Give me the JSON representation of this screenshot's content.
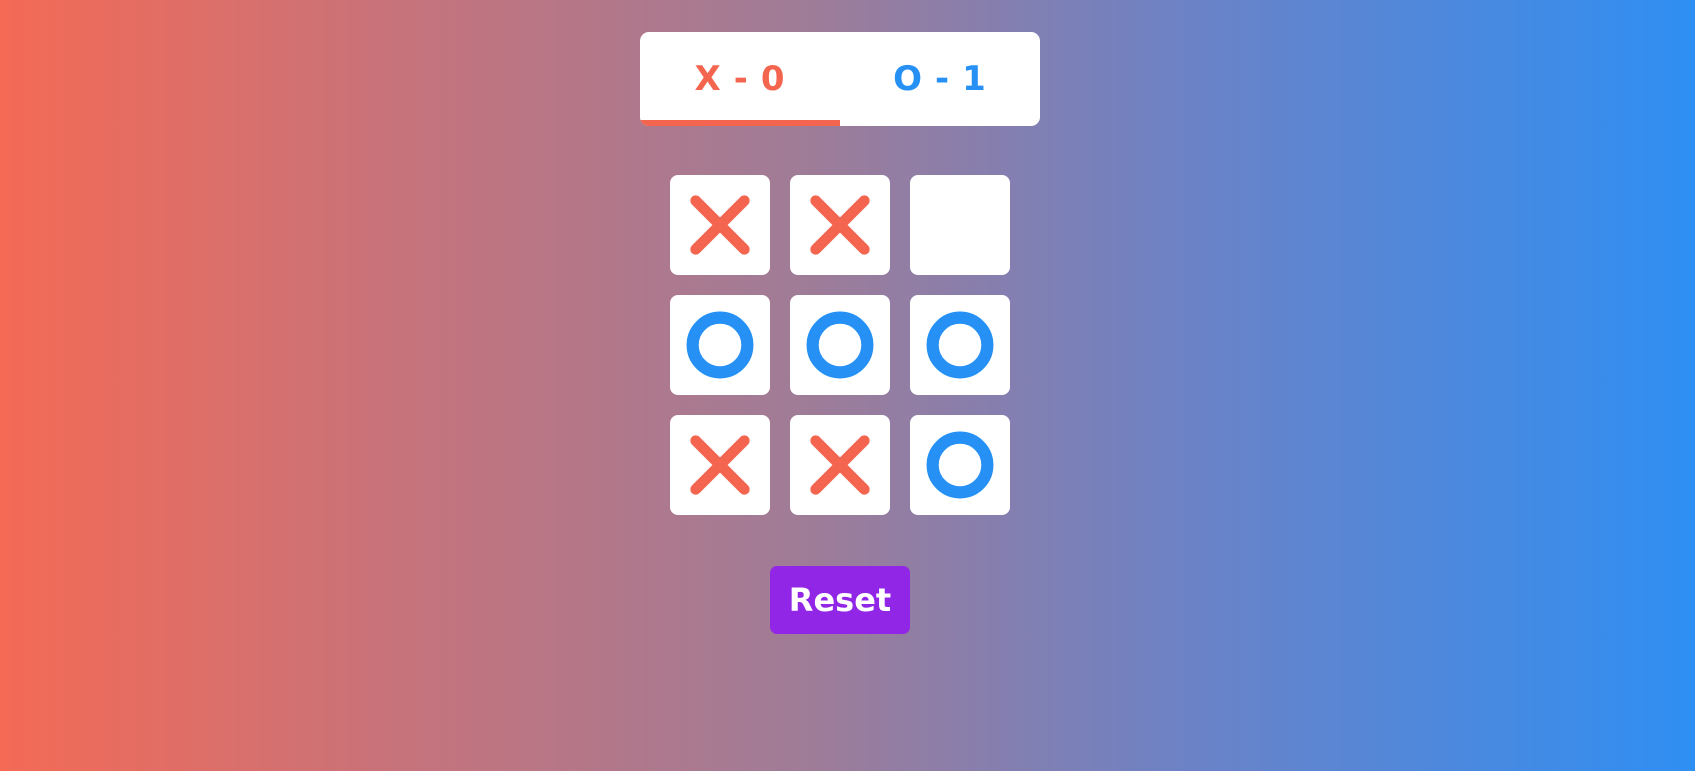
{
  "colors": {
    "x": "#f4654f",
    "o": "#2790f5",
    "panel": "#ffffff",
    "reset_button": "#9126e6"
  },
  "scoreboard": {
    "x": {
      "symbol": "X",
      "separator": "-",
      "score": "0"
    },
    "o": {
      "symbol": "O",
      "separator": "-",
      "score": "1"
    },
    "active_player": "X"
  },
  "board": {
    "cells": [
      "X",
      "X",
      "",
      "O",
      "O",
      "O",
      "X",
      "X",
      "O"
    ]
  },
  "controls": {
    "reset_label": "Reset"
  }
}
